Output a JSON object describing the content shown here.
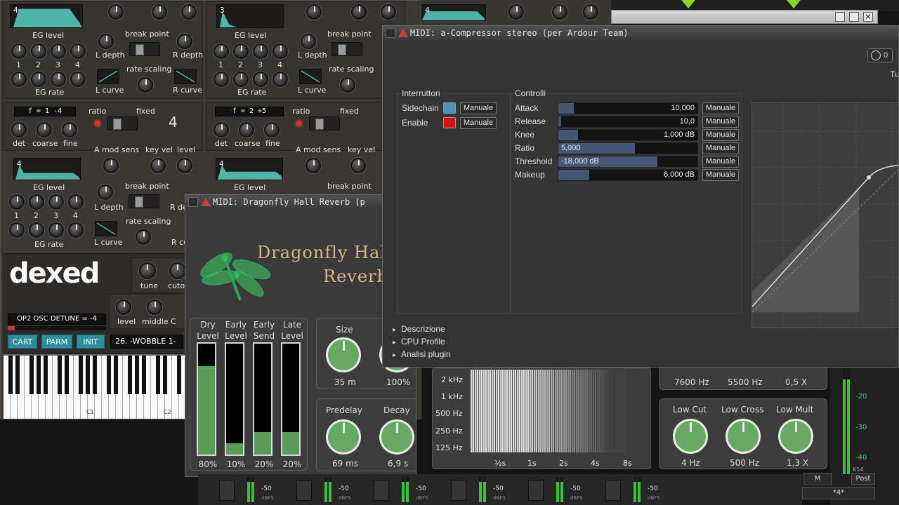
{
  "dexed": {
    "op1": {
      "eg_label": "EG level",
      "eg_num": "4",
      "nums": [
        "1",
        "2",
        "3",
        "4"
      ],
      "eg_rate": "EG rate",
      "break_point": "break point",
      "l_depth": "L depth",
      "r_depth": "R depth",
      "rate_scaling": "rate scaling",
      "l_curve": "L curve",
      "r_curve": "R curve"
    },
    "op2": {
      "eg_num": "3"
    },
    "op3": {
      "eg_num": "4"
    },
    "osc_a": {
      "lcd": "f = 1 -4",
      "ratio": "ratio",
      "fixed": "fixed",
      "op_num": "4",
      "det": "det",
      "coarse": "coarse",
      "fine": "fine",
      "a_mod_sens": "A mod sens",
      "key_vel": "key vel",
      "level": "level"
    },
    "osc_b": {
      "lcd": "f = 2 +5",
      "ratio": "ratio",
      "fixed": "fixed"
    },
    "op_lower": {
      "eg_num": "4",
      "eg_label": "EG level",
      "eg_rate": "EG rate",
      "break_point": "break point",
      "l_depth": "L depth",
      "r_depth": "R de",
      "rate_scaling": "rate scaling",
      "l_curve": "L curve",
      "r_curve": "R cu"
    },
    "op_lower_b": {
      "eg_num": "4",
      "eg_label": "EG level",
      "break_point": "break point"
    },
    "logo": "dexed",
    "tune": "tune",
    "cutoff": "cutof",
    "level": "level",
    "middle_c": "middle C",
    "status_lcd": "OP2 OSC DETUNE = -4",
    "buttons": {
      "cart": "CART",
      "parm": "PARM",
      "init": "INIT"
    },
    "program": "26. -WOBBLE 1-",
    "key_c1": "C1",
    "key_c2": "C2"
  },
  "dragonfly": {
    "window_title": "MIDI: Dragonfly Hall Reverb (p",
    "title_line1": "Dragonfly Hal",
    "title_line2": "Reverb",
    "meters": [
      {
        "label1": "Dry",
        "label2": "Level",
        "value": "80%",
        "fraction": 0.8
      },
      {
        "label1": "Early",
        "label2": "Level",
        "value": "10%",
        "fraction": 0.1
      },
      {
        "label1": "Early",
        "label2": "Send",
        "value": "20%",
        "fraction": 0.2
      },
      {
        "label1": "Late",
        "label2": "Level",
        "value": "20%",
        "fraction": 0.2
      }
    ],
    "size": {
      "label": "Size",
      "value": "35 m"
    },
    "width_value": "100%",
    "predelay": {
      "label": "Predelay",
      "value": "69 ms"
    },
    "decay": {
      "label": "Decay",
      "value": "6,9 s"
    }
  },
  "spectrogram": {
    "freq_labels": [
      "2 kHz",
      "1 kHz",
      "500 Hz",
      "250 Hz",
      "125 Hz"
    ],
    "time_labels": [
      "½s",
      "1s",
      "2s",
      "4s",
      "8s"
    ]
  },
  "right_panel": {
    "top_values": [
      "7600 Hz",
      "5500 Hz",
      "0,5 X"
    ],
    "low_cut": {
      "label": "Low Cut",
      "value": "4 Hz"
    },
    "low_cross": {
      "label": "Low Cross",
      "value": "500 Hz"
    },
    "low_mult": {
      "label": "Low Mult",
      "value": "1,3 X"
    }
  },
  "compressor": {
    "window_title": "MIDI: a-Compressor stereo (per Ardour Team)",
    "top_counter": "0",
    "top_right_text": "Tut",
    "switches_title": "Interruttori",
    "switches": [
      {
        "label": "Sidechain",
        "button": "Manuale",
        "color": "#4f90b6"
      },
      {
        "label": "Enable",
        "button": "Manuale",
        "color": "#d01414"
      }
    ],
    "controls_title": "Controlli",
    "controls": [
      {
        "label": "Attack",
        "value": "10,000",
        "fraction": 0.11,
        "button": "Manuale"
      },
      {
        "label": "Release",
        "value": "10,0",
        "fraction": 0.02,
        "button": "Manuale"
      },
      {
        "label": "Knee",
        "value": "1,000 dB",
        "fraction": 0.14,
        "button": "Manuale"
      },
      {
        "label": "Ratio",
        "value": "5,000",
        "fraction": 0.55,
        "button": "Manuale"
      },
      {
        "label": "Threshold",
        "value": "-18,000 dB",
        "fraction": 0.71,
        "button": "Manuale"
      },
      {
        "label": "Makeup",
        "value": "6,000 dB",
        "fraction": 0.22,
        "button": "Manuale"
      }
    ],
    "expanders": [
      "Descrizione",
      "CPU Profile",
      "Analisi plugin"
    ]
  },
  "meter_bridge": {
    "scale": [
      "-20",
      "-30",
      "-40"
    ],
    "k14": "K14",
    "post": "Post",
    "m": "M",
    "bottom": "*4*",
    "strip_label": "-50",
    "dbfs": "dBFS",
    "zero": "0"
  }
}
